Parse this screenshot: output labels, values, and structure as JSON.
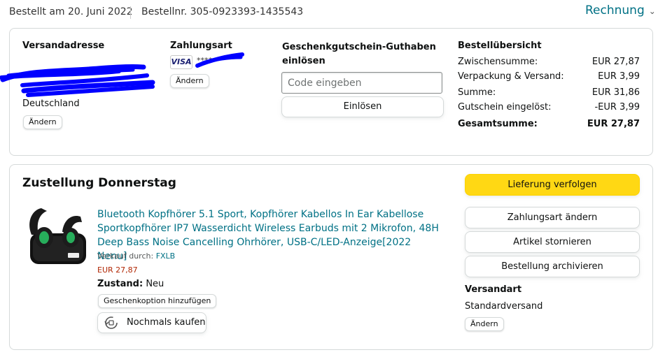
{
  "header": {
    "ordered_on": "Bestellt am 20. Juni 2022",
    "order_number": "Bestellnr. 305-0923393-1435543",
    "invoice_label": "Rechnung"
  },
  "shipping": {
    "heading": "Versandadresse",
    "country": "Deutschland",
    "change_label": "Ändern"
  },
  "payment": {
    "heading": "Zahlungsart",
    "card_brand": "VISA",
    "card_masked": "****",
    "change_label": "Ändern"
  },
  "giftcard": {
    "heading_line1": "Geschenkgutschein-Guthaben",
    "heading_line2": "einlösen",
    "placeholder": "Code eingeben",
    "redeem_label": "Einlösen"
  },
  "summary": {
    "heading": "Bestellübersicht",
    "rows": [
      {
        "label": "Zwischensumme:",
        "value": "EUR 27,87"
      },
      {
        "label": "Verpackung & Versand:",
        "value": "EUR 3,99"
      },
      {
        "label": "Summe:",
        "value": "EUR 31,86"
      },
      {
        "label": "Gutschein eingelöst:",
        "value": "-EUR 3,99"
      }
    ],
    "total": {
      "label": "Gesamtsumme:",
      "value": "EUR 27,87"
    }
  },
  "delivery": {
    "title": "Zustellung Donnerstag",
    "product": {
      "title": "Bluetooth Kopfhörer 5.1 Sport, Kopfhörer Kabellos In Ear Kabellose Sportkopfhörer IP7 Wasserdicht Wireless Earbuds mit 2 Mikrofon, 48H Deep Bass Noise Cancelling Ohrhörer, USB-C/LED-Anzeige[2022 Nenu]",
      "seller_prefix": "Verkauf durch: ",
      "seller": "FXLB",
      "price": "EUR 27,87",
      "condition_label": "Zustand:",
      "condition_value": "Neu",
      "gift_option_label": "Geschenkoption hinzufügen",
      "buy_again_label": "Nochmals kaufen"
    },
    "actions": {
      "track": "Lieferung verfolgen",
      "change_payment": "Zahlungsart ändern",
      "cancel": "Artikel stornieren",
      "archive": "Bestellung archivieren"
    },
    "shipping_method": {
      "heading": "Versandart",
      "value": "Standardversand",
      "change_label": "Ändern"
    }
  },
  "colors": {
    "link": "#007185",
    "price": "#b12704",
    "primary_button": "#ffd814",
    "redaction": "#0000ff"
  }
}
